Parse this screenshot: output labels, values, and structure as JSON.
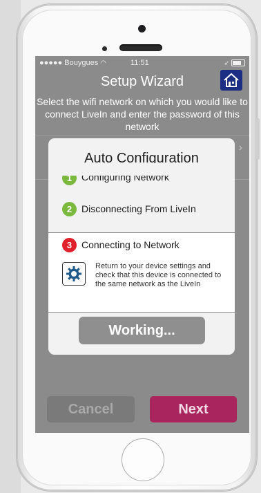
{
  "status_bar": {
    "carrier": "●●●●● Bouygues",
    "time": "11:51",
    "wifi_icon": "wifi-icon",
    "location_icon": "location-arrow-icon",
    "battery_icon": "battery-icon"
  },
  "header": {
    "title": "Setup Wizard",
    "home_icon": "home-icon",
    "home_color": "#1b2e84"
  },
  "instructions": "Select the wifi network on which you would like to connect LiveIn and enter the password of this network",
  "modal": {
    "title": "Auto Configuration",
    "steps": [
      {
        "number": "1",
        "label": "Configuring Network",
        "color": "#7ab93d"
      },
      {
        "number": "2",
        "label": "Disconnecting From LiveIn",
        "color": "#7ab93d"
      },
      {
        "number": "3",
        "label": "Connecting to Network",
        "color": "#e0202a"
      }
    ],
    "help_icon": "gear-icon",
    "help_text": "Return to your device settings and check that this device is connected to the same network as the LiveIn",
    "working_label": "Working..."
  },
  "footer": {
    "cancel_label": "Cancel",
    "next_label": "Next",
    "next_color": "#a8255e"
  }
}
